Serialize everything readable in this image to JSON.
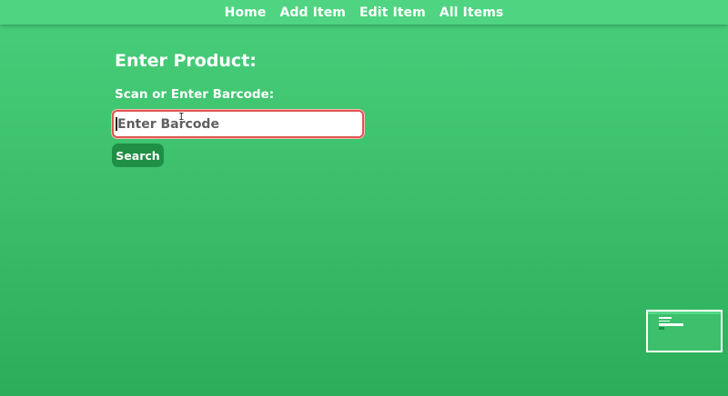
{
  "nav": {
    "items": [
      {
        "label": "Home"
      },
      {
        "label": "Add Item"
      },
      {
        "label": "Edit Item"
      },
      {
        "label": "All Items"
      }
    ]
  },
  "main": {
    "title": "Enter Product:",
    "barcode_label": "Scan or Enter Barcode:",
    "barcode_input": {
      "value": "",
      "placeholder": "Enter Barcode"
    },
    "search_label": "Search"
  },
  "colors": {
    "background": "#3cc06b",
    "navbar": "#4fd481",
    "button": "#1f8f45",
    "input_border": "#e0564f"
  },
  "icons": {
    "cursor": "text-cursor-icon"
  }
}
